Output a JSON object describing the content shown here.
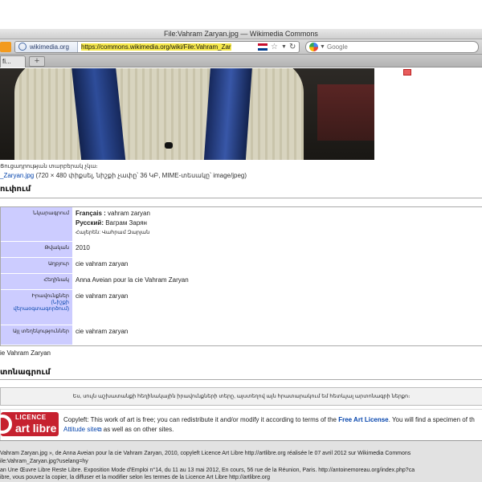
{
  "window": {
    "title": "File:Vahram Zaryan.jpg — Wikimedia Commons"
  },
  "nav": {
    "site_identity": "wikimedia.org",
    "url": "https://commons.wikimedia.org/wiki/File:Vahram_Zar",
    "search_placeholder": "Google",
    "icons": [
      "rss-icon",
      "globe-icon",
      "flag-icon",
      "star-icon",
      "chevron-down-icon",
      "reload-icon",
      "google-icon"
    ]
  },
  "tabs": {
    "active_label": "fi...",
    "new_tab": "+"
  },
  "page": {
    "caption_top": "Ցուցադրության տարբերակ չկա։",
    "file_link": "_Zaryan.jpg",
    "file_meta": " (720 × 480 փիքսել, նիշքի չափը՝ 36 ԿԲ, MIME-տեսակը՝ image/jpeg)",
    "section_description": "ուփում",
    "info": {
      "rows": [
        {
          "key": "Նկարագրում",
          "lines": [
            {
              "lang": "Français :",
              "text": " vahram zaryan"
            },
            {
              "lang": "Русский:",
              "text": " Ваграм Зарян"
            },
            {
              "lang": "",
              "text": "Հայերեն: Վահրամ Զարյան"
            }
          ]
        },
        {
          "key": "Թվական",
          "value": "2010"
        },
        {
          "key": "Աղբյուր",
          "value": "cie vahram zaryan"
        },
        {
          "key": "Հեղինակ",
          "value": "Anna Aveian pour la cie Vahram Zaryan"
        },
        {
          "key": "Իրավունքներ",
          "key_sub": "(Նիշքի վերաօգտագործում)",
          "value": "cie vahram zaryan"
        },
        {
          "key": "Այլ տեղեկություններ",
          "value": "cie vahram zaryan"
        }
      ]
    },
    "category_line": "ie Vahram Zaryan",
    "section_licensing": "տոնագրում",
    "consent_text": "Ես, սույն աշխատանքի հեղինակային իրավունքների տերը, այստեղով այն հրատարակում եմ հետևյալ արտոնագրի ներքո։",
    "license": {
      "logo_top": "LICENCE",
      "logo_bottom": "art libre",
      "text_prefix": "Copyleft: This work of art is free; you can redistribute it and/or modify it according to terms of the ",
      "link": "Free Art License",
      "text_suffix": ". You will find a specimen of th",
      "line2_link": "Attitude site",
      "line2_rest": " as well as on other sites."
    }
  },
  "status": {
    "lines": [
      "Vahram Zaryan.jpg », de Anna Aveian pour la cie Vahram Zaryan, 2010, copyleft Licence Art Libre http://artlibre.org réalisée le 07 avril 2012 sur Wikimedia Commons",
      "ile:Vahram_Zaryan.jpg?uselang=hy",
      "an Une Œuvre Libre Reste Libre. Exposition Mode d'Emploi n°14, du 11 au 13 mai 2012, En cours, 56 rue de la Réunion, Paris. http://antoinemoreau.org/index.php?ca",
      "ibre, vous pouvez la copier, la diffuser et la modifier selon les termes de la Licence Art Libre http://artlibre.org"
    ]
  }
}
